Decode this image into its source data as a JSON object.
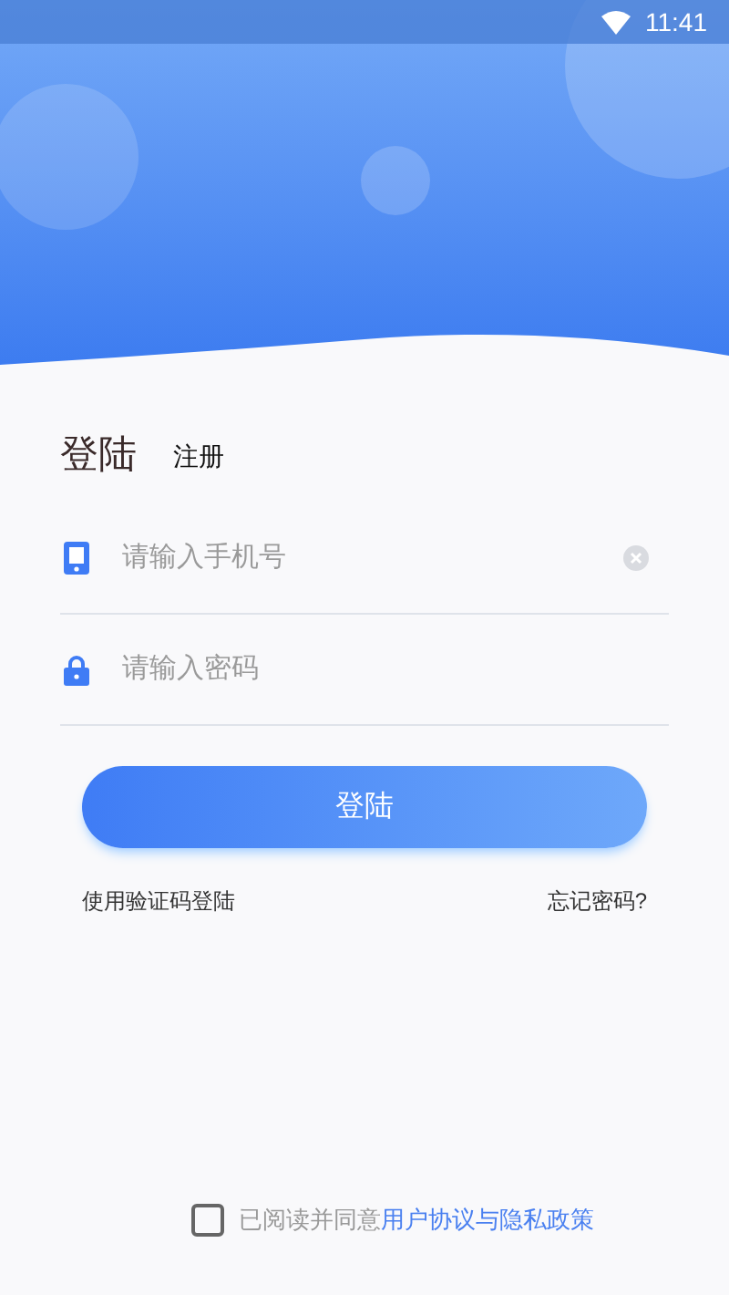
{
  "status_bar": {
    "time": "11:41"
  },
  "tabs": [
    {
      "label": "登陆",
      "selected": true
    },
    {
      "label": "注册",
      "selected": false
    }
  ],
  "fields": [
    {
      "kind": "phone",
      "placeholder": "请输入手机号",
      "clearable": true
    },
    {
      "kind": "password",
      "placeholder": "请输入密码",
      "clearable": false
    }
  ],
  "login_button": "登陆",
  "links": {
    "sms_login": "使用验证码登陆",
    "forgot_password": "忘记密码?"
  },
  "agreement": {
    "checked": false,
    "text": "已阅读并同意",
    "link": "用户协议与隐私政策"
  }
}
